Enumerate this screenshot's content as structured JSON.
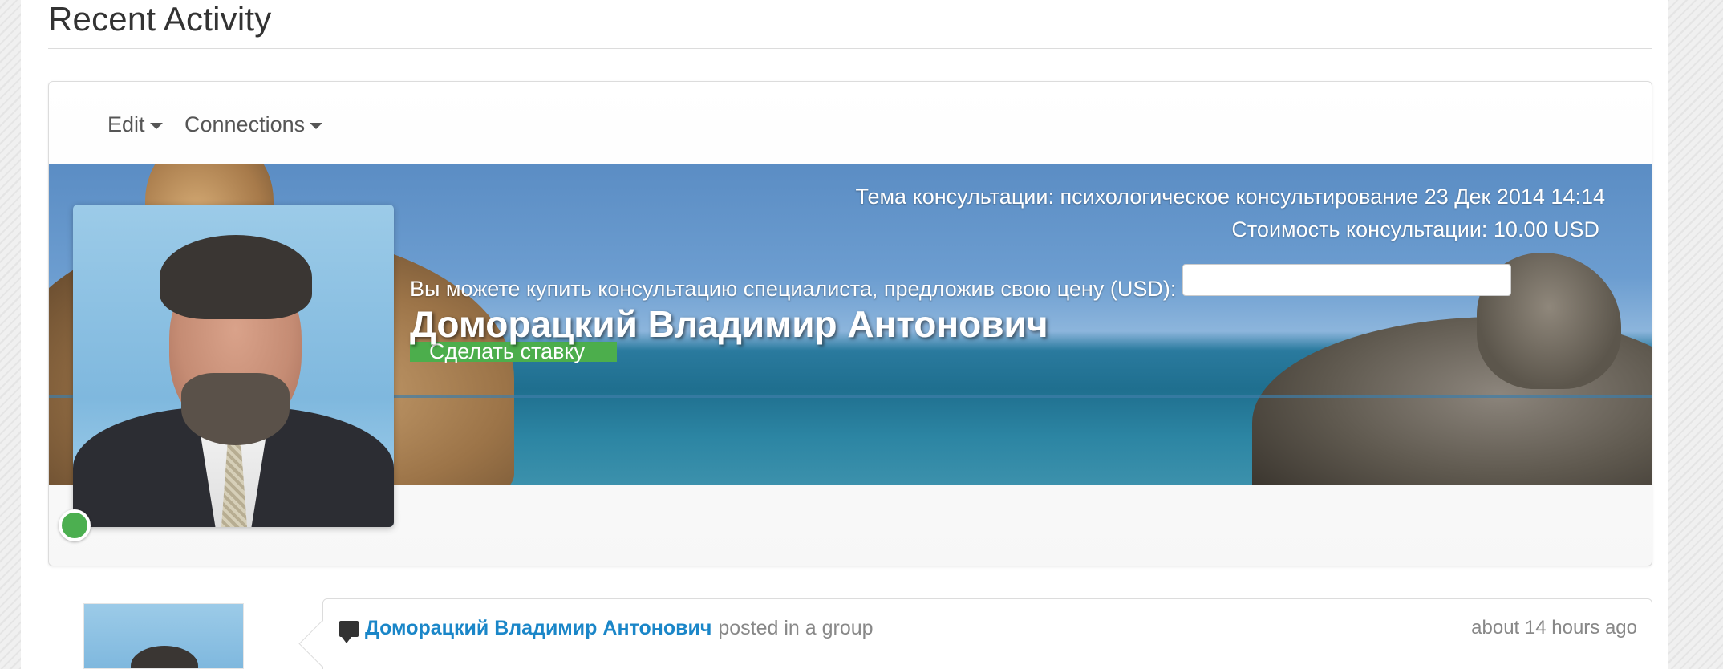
{
  "page": {
    "title": "Recent Activity"
  },
  "toolbar": {
    "edit_label": "Edit",
    "connections_label": "Connections"
  },
  "cover": {
    "topic_line": "Тема консультации: психологическое консультирование 23 Дек 2014 14:14",
    "price_line": "Стоимость консультации: 10.00 USD",
    "offer_label": "Вы можете купить консультацию специалиста, предложив свою цену (USD):",
    "bid_value": "",
    "bid_button_label": "Сделать ставку"
  },
  "profile": {
    "name": "Доморацкий Владимир Антонович",
    "status": "online",
    "status_color": "#4caf50"
  },
  "activity": {
    "items": [
      {
        "author": "Доморацкий Владимир Антонович",
        "verb": "posted in a group",
        "time": "about 14 hours ago",
        "icon": "comment-icon"
      }
    ]
  },
  "colors": {
    "link": "#1a86c8",
    "accent_green": "#4cae4c"
  }
}
